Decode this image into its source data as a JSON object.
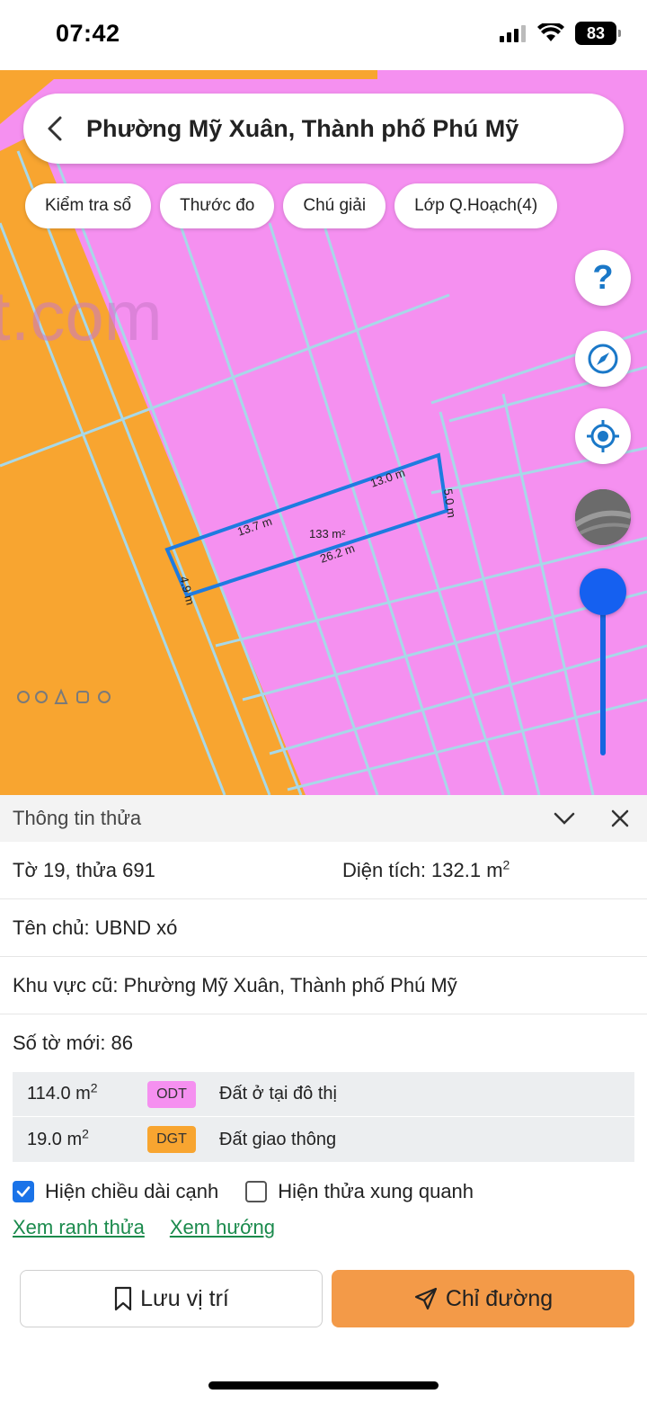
{
  "status_bar": {
    "time": "07:42",
    "battery": "83",
    "icons": [
      "signal-icon",
      "wifi-icon",
      "battery-icon"
    ]
  },
  "search": {
    "title": "Phường Mỹ Xuân, Thành phố Phú Mỹ"
  },
  "chips": [
    {
      "label": "Kiểm tra sổ"
    },
    {
      "label": "Thước đo"
    },
    {
      "label": "Chú giải"
    },
    {
      "label": "Lớp Q.Hoạch(4)"
    }
  ],
  "map": {
    "watermark": "t.com",
    "parcel": {
      "edge_top_right": "13.0 m",
      "edge_top_left": "13.7 m",
      "edge_right": "5.0 m",
      "edge_bottom": "26.2 m",
      "edge_left": "4.9 m",
      "area": "133 m²"
    },
    "colors": {
      "residential": "#f590f0",
      "road": "#f8a530",
      "parcel_outline": "#1e7be0",
      "grid_lines": "#a8d8e8"
    },
    "controls": {
      "help": "?"
    }
  },
  "panel": {
    "title": "Thông tin thửa",
    "sheet_plot": "Tờ 19, thửa 691",
    "area_label": "Diện tích: 132.1 m",
    "area_sup": "2",
    "owner": "Tên chủ: UBND xó",
    "old_area": "Khu vực cũ: Phường Mỹ Xuân, Thành phố Phú Mỹ",
    "new_sheet": "Số tờ mới: 86",
    "usage": [
      {
        "area": "114.0 m",
        "sup": "2",
        "code": "ODT",
        "name": "Đất ở tại đô thị",
        "color": "#f590f0"
      },
      {
        "area": "19.0 m",
        "sup": "2",
        "code": "DGT",
        "name": "Đất giao thông",
        "color": "#f8a530"
      }
    ],
    "show_edge_lengths": "Hiện chiều dài cạnh",
    "show_surrounding": "Hiện thửa xung quanh",
    "link_boundary": "Xem ranh thửa",
    "link_direction": "Xem hướng",
    "save_label": "Lưu vị trí",
    "route_label": "Chỉ đường"
  }
}
